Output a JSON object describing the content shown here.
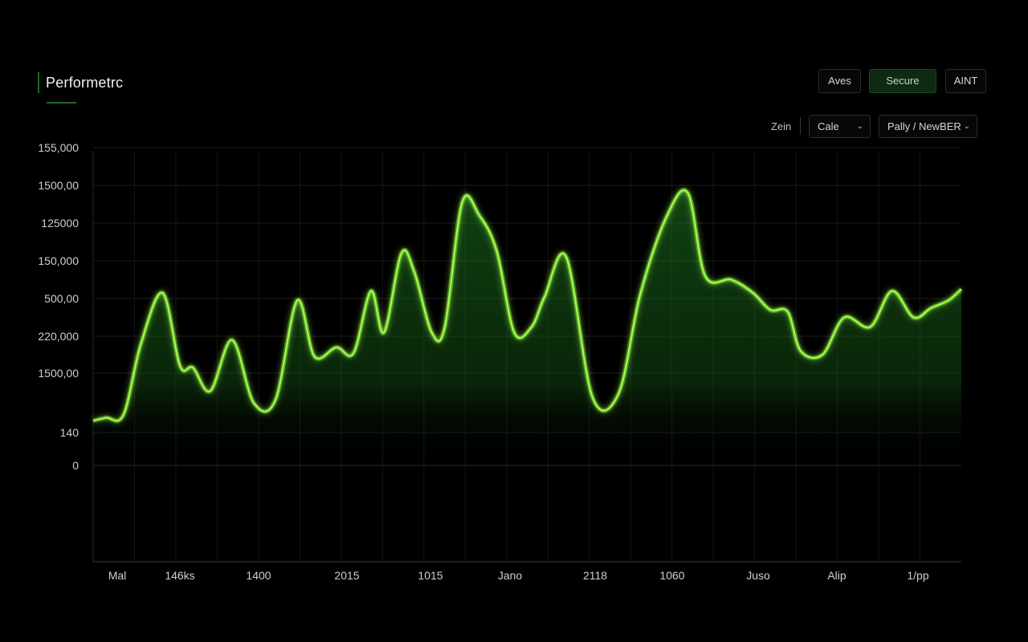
{
  "header": {
    "title": "Performetrc"
  },
  "toolbar": {
    "buttons": [
      {
        "label": "Aves"
      },
      {
        "label": "Secure"
      },
      {
        "label": "AINT"
      }
    ]
  },
  "filters": {
    "zoom_label": "Zein",
    "selects": [
      {
        "value": "Cale"
      },
      {
        "value": "Pally / NewBER"
      }
    ]
  },
  "colors": {
    "line": "#9dff4a",
    "area": "#1f7a1f",
    "accent": "#1e6b22"
  },
  "chart_data": {
    "type": "area",
    "title": "Performetrc",
    "xlabel": "",
    "ylabel": "",
    "grid": true,
    "y_tick_labels": [
      "155,000",
      "1500,00",
      "125000",
      "150,000",
      "500,00",
      "220,000",
      "1500,00",
      "140",
      "0"
    ],
    "x_tick_labels": [
      "Mal",
      "146ks",
      "1400",
      "2015",
      "1015",
      "Jano",
      "2118",
      "1060",
      "Juso",
      "Alip",
      "1/pp"
    ],
    "note_scale": "value index: 0 = '0' tick, 8 = '155,000' tick",
    "series": [
      {
        "x": [
          0,
          0.15,
          0.35,
          0.55,
          0.8,
          1.0,
          1.15,
          1.35,
          1.6,
          1.85,
          2.1,
          2.35,
          2.55,
          2.8,
          3.0,
          3.2,
          3.35,
          3.55,
          3.7,
          3.9,
          4.05,
          4.25,
          4.45,
          4.65,
          4.85,
          5.05,
          5.2,
          5.45,
          5.75,
          6.05,
          6.3,
          6.6,
          6.85,
          7.05,
          7.35,
          7.6,
          7.8,
          8.0,
          8.15,
          8.4,
          8.65,
          8.95,
          9.2,
          9.45,
          9.65,
          9.85,
          10.0
        ],
        "values": [
          1.2,
          1.25,
          1.3,
          2.8,
          4.15,
          2.2,
          2.15,
          1.7,
          2.9,
          1.5,
          1.55,
          3.95,
          2.45,
          2.7,
          2.55,
          4.2,
          3.1,
          5.2,
          4.7,
          3.1,
          3.25,
          6.55,
          6.2,
          5.25,
          3.1,
          3.25,
          4.05,
          5.1,
          1.6,
          1.65,
          4.1,
          6.15,
          6.8,
          4.6,
          4.5,
          4.15,
          3.7,
          3.65,
          2.6,
          2.5,
          3.5,
          3.25,
          4.2,
          3.5,
          3.75,
          3.95,
          4.25
        ]
      }
    ]
  }
}
